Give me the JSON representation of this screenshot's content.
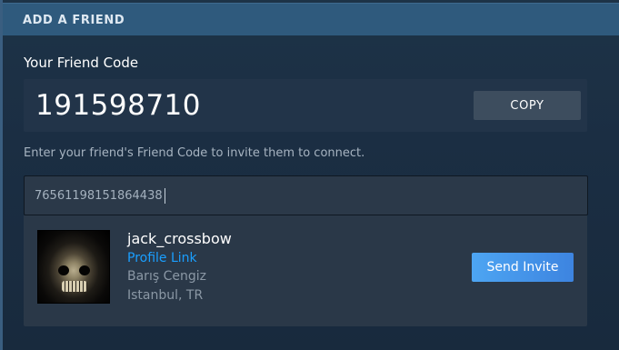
{
  "header": {
    "title": "ADD A FRIEND"
  },
  "friend_code": {
    "label": "Your Friend Code",
    "value": "191598710",
    "copy_label": "COPY"
  },
  "invite": {
    "hint": "Enter your friend's Friend Code to invite them to connect.",
    "input_value": "76561198151864438"
  },
  "result": {
    "username": "jack_crossbow",
    "profile_link": "Profile Link",
    "real_name": "Barış Cengiz",
    "location": "Istanbul, TR",
    "send_label": "Send Invite"
  },
  "colors": {
    "accent": "#1a9fff",
    "header": "#2f5a7d",
    "button_gradient": [
      "#4da5f2",
      "#3d84e0"
    ]
  },
  "icons": {
    "avatar": "skull-avatar"
  }
}
